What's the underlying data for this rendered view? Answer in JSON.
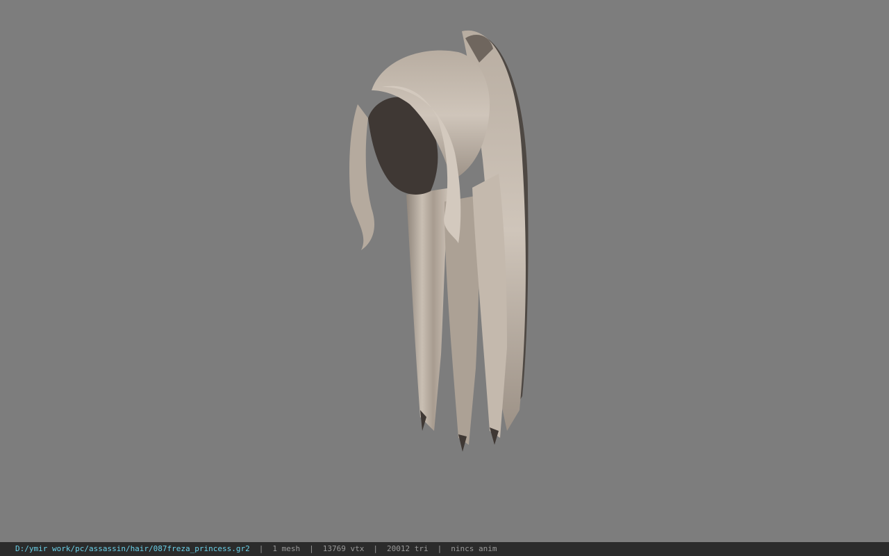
{
  "viewport": {
    "background": "#7d7d7d",
    "model_name": "087freza_princess"
  },
  "statusbar": {
    "path": "D:/ymir work/pc/assassin/hair/087freza_princess.gr2",
    "mesh": "1 mesh",
    "vertices": "13769 vtx",
    "triangles": "20012 tri",
    "anim": "nincs anim",
    "separator": "|",
    "path_color": "#6ad0e8",
    "text_color": "#9a9a9a"
  }
}
